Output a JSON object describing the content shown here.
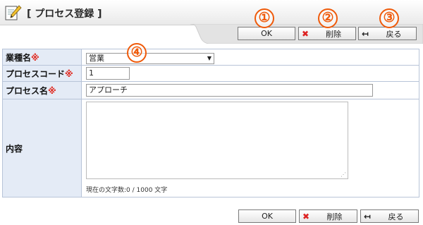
{
  "header": {
    "title": "[ プロセス登録 ]",
    "icon": "edit-document-icon"
  },
  "toolbar_top": {
    "ok_label": "OK",
    "delete_label": "削除",
    "back_label": "戻る"
  },
  "toolbar_bottom": {
    "ok_label": "OK",
    "delete_label": "削除",
    "back_label": "戻る"
  },
  "icons": {
    "delete": "x-icon",
    "back": "back-arrow-icon"
  },
  "annotations": [
    "①",
    "②",
    "③",
    "④"
  ],
  "form": {
    "required_mark": "※",
    "industry": {
      "label": "業種名",
      "value": "営業"
    },
    "process_code": {
      "label": "プロセスコード",
      "value": "1"
    },
    "process_name": {
      "label": "プロセス名",
      "value": "アプローチ"
    },
    "content": {
      "label": "内容",
      "value": "",
      "char_count": "現在の文字数:0 / 1000 文字"
    }
  },
  "colors": {
    "annotation": "#ef5a0a",
    "required": "#e0281e",
    "label_bg": "#e4ebf6",
    "border": "#b8c4d8"
  }
}
